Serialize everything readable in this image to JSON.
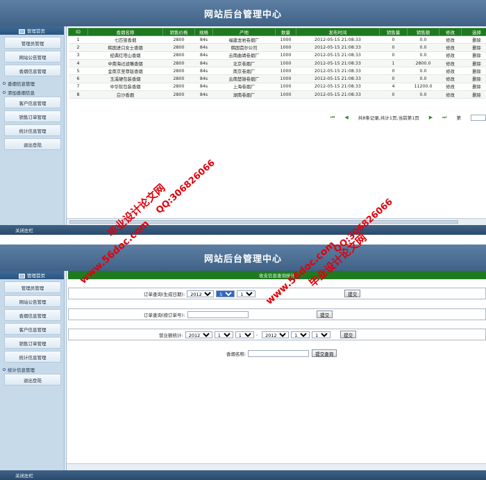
{
  "header_title": "网站后台管理中心",
  "footer_label": "关闭左栏",
  "panel1": {
    "sidebar_top": "管理首页",
    "items": [
      "管理员管理",
      "网站公告管理",
      "香烟信息管理"
    ],
    "subitems": [
      "香烟信息管理",
      "添加香烟信息"
    ],
    "items_after": [
      "客户信息管理",
      "销售订单管理",
      "统计信息管理",
      "退出登陆"
    ],
    "table": {
      "headers": [
        "ID",
        "香烟名称",
        "销售价格",
        "规格",
        "产地",
        "数量",
        "发布时间",
        "销售量",
        "销售额",
        "修改",
        "选择"
      ],
      "rows": [
        [
          "1",
          "七匹狼香烟",
          "2800",
          "84s",
          "福建龙岩卷烟厂",
          "1000",
          "2012-05-15 21:08:33",
          "0",
          "0.0",
          "修改",
          "删除"
        ],
        [
          "2",
          "韩国进口女士香烟",
          "2800",
          "84s",
          "韩国首尔公司",
          "1000",
          "2012-05-15 21:08:33",
          "0",
          "0.0",
          "修改",
          "删除"
        ],
        [
          "3",
          "经典红塔山香烟",
          "2800",
          "84s",
          "云南曲靖卷烟厂",
          "1000",
          "2012-05-15 21:08:33",
          "0",
          "0.0",
          "修改",
          "删除"
        ],
        [
          "4",
          "中南海过滤嘴香烟",
          "2800",
          "84s",
          "北京卷烟厂",
          "1000",
          "2012-05-15 21:08:33",
          "1",
          "2800.0",
          "修改",
          "删除"
        ],
        [
          "5",
          "金南京至尊版香烟",
          "2800",
          "84s",
          "南京卷烟厂",
          "1000",
          "2012-05-15 21:08:33",
          "0",
          "0.0",
          "修改",
          "删除"
        ],
        [
          "6",
          "玉溪硬包装香烟",
          "2800",
          "84s",
          "云南楚雄卷烟厂",
          "1000",
          "2012-05-15 21:08:33",
          "0",
          "0.0",
          "修改",
          "删除"
        ],
        [
          "7",
          "中华软包装香烟",
          "2800",
          "84s",
          "上海卷烟厂",
          "1000",
          "2012-05-15 21:08:33",
          "4",
          "11200.0",
          "修改",
          "删除"
        ],
        [
          "8",
          "白沙香烟",
          "2800",
          "84s",
          "湖南卷烟厂",
          "1000",
          "2012-05-15 21:08:33",
          "0",
          "0.0",
          "修改",
          "删除"
        ]
      ]
    },
    "pager_text": "共8条记录,共计1页,当前第1页",
    "pager_go_label": "第"
  },
  "panel2": {
    "sidebar_top": "管理首页",
    "items": [
      "管理员管理",
      "网站公告管理",
      "香烟信息管理",
      "客户信息管理",
      "销售订单管理",
      "统计信息管理"
    ],
    "subitems": [
      "统计信息管理"
    ],
    "items_after": [
      "退出登陆"
    ],
    "banner": "收支信息查询统计",
    "q1_label": "订单查询(生成日期):",
    "q1_year": "2012",
    "q1_month": "5",
    "q1_day": "1",
    "q2_label": "订单查询(按订单号):",
    "q3_label": "营业额统计:",
    "q3_from": [
      "2012",
      "1",
      "1"
    ],
    "q3_sep": "-",
    "q3_to": [
      "2012",
      "1",
      "1"
    ],
    "q4_label": "香烟名称:",
    "submit_label": "提交",
    "submit_query_label": "提交查询"
  },
  "watermark": {
    "site": "www.56doc.com",
    "brand": "毕业设计论文网",
    "qq": "QQ:306826066",
    "color": "#e0000b"
  }
}
